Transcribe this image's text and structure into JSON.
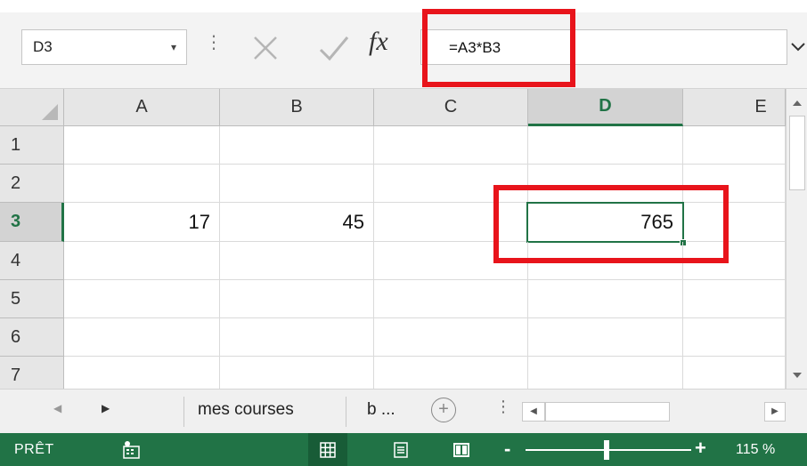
{
  "formula_bar": {
    "name_box": "D3",
    "name_box_arrow": "▾",
    "dots": "⋮",
    "fx": "fx",
    "formula": "=A3*B3",
    "expand_icon": "⌄"
  },
  "grid": {
    "columns": [
      "A",
      "B",
      "C",
      "D",
      "E"
    ],
    "selected_column": "D",
    "rows": [
      "1",
      "2",
      "3",
      "4",
      "5",
      "6",
      "7"
    ],
    "selected_row": "3",
    "cells": {
      "A3": "17",
      "B3": "45",
      "D3": "765"
    },
    "active_cell": "D3"
  },
  "tabs_bar": {
    "prev_icon": "◀",
    "next_icon": "▶",
    "sheets": [
      "mes courses",
      "b ..."
    ],
    "add_icon": "+",
    "dots": "⋮",
    "scroll_left_icon": "◀",
    "scroll_right_icon": "▶"
  },
  "status_bar": {
    "status": "PRÊT",
    "zoom_minus": "-",
    "zoom_plus": "+",
    "zoom_level": "115 %",
    "zoom_value_percent": 115
  },
  "annotation_color": "#e8141b",
  "accent_color": "#217346"
}
